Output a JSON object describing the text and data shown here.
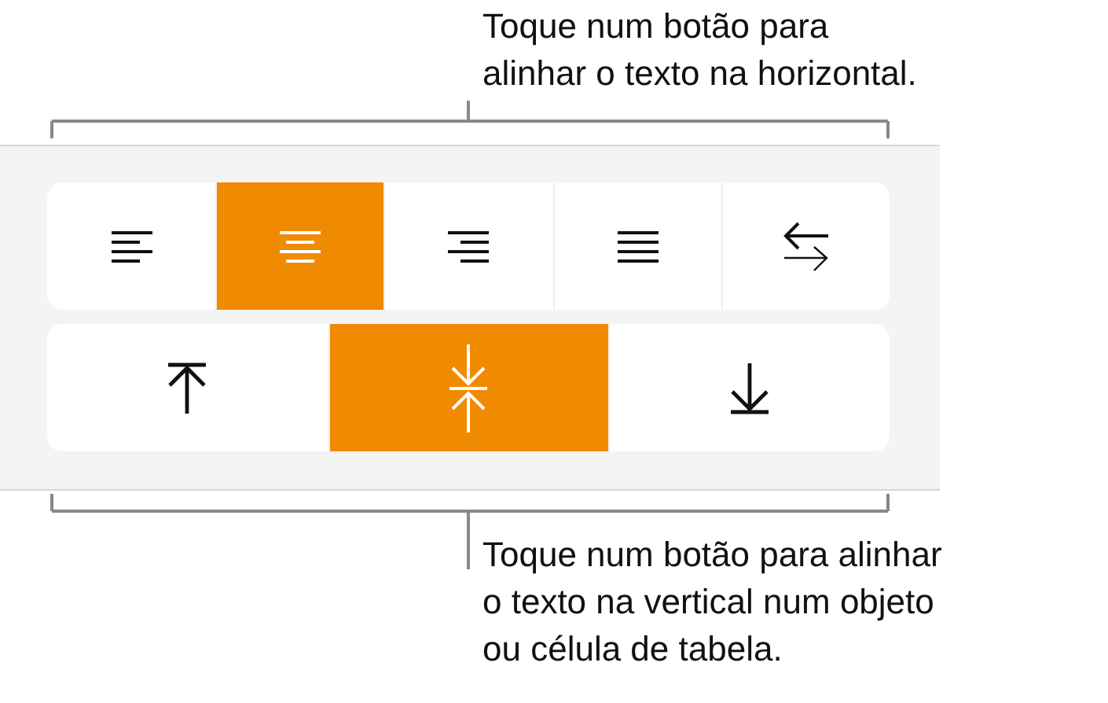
{
  "top_callout": "Toque num botão para\nalinhar o texto na horizontal.",
  "horizontal_alignment": [
    {
      "kind": "left",
      "selected": false
    },
    {
      "kind": "center",
      "selected": true
    },
    {
      "kind": "right",
      "selected": false
    },
    {
      "kind": "justify",
      "selected": false
    },
    {
      "kind": "direction",
      "selected": false
    }
  ],
  "vertical_alignment": [
    {
      "kind": "top",
      "selected": false
    },
    {
      "kind": "middle",
      "selected": true
    },
    {
      "kind": "bottom",
      "selected": false
    }
  ],
  "bottom_callout": "Toque num botão para alinhar\no texto na vertical num objeto\nou célula de tabela."
}
